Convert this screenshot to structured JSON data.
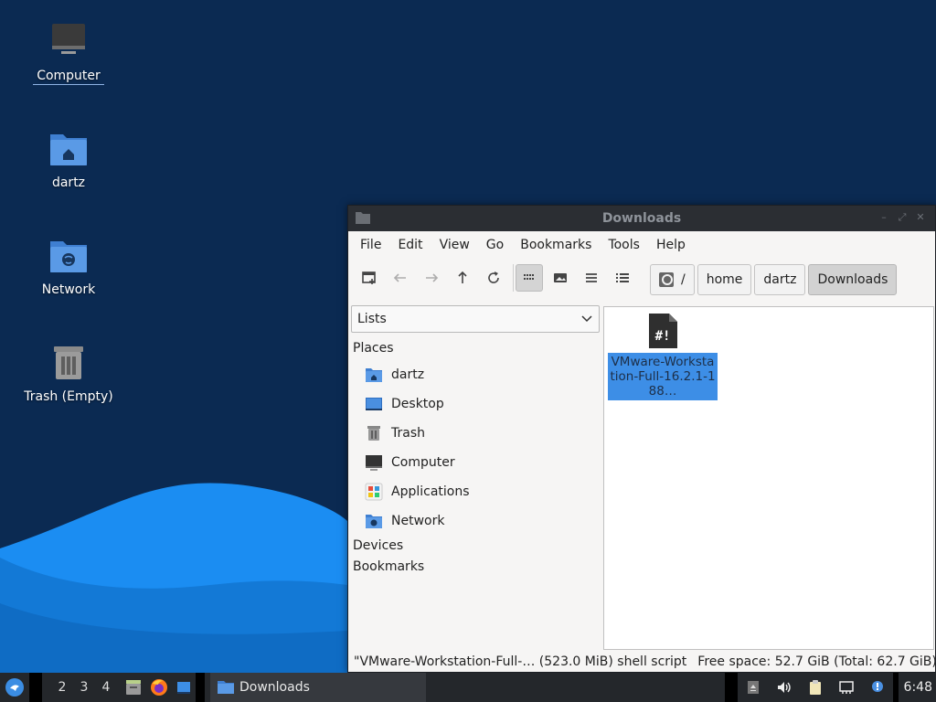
{
  "desktop": {
    "icons": [
      {
        "label": "Computer",
        "icon": "computer-icon"
      },
      {
        "label": "dartz",
        "icon": "home-folder-icon"
      },
      {
        "label": "Network",
        "icon": "network-folder-icon"
      },
      {
        "label": "Trash (Empty)",
        "icon": "trash-icon"
      }
    ]
  },
  "window": {
    "title": "Downloads",
    "menu": [
      "File",
      "Edit",
      "View",
      "Go",
      "Bookmarks",
      "Tools",
      "Help"
    ],
    "toolbar": {
      "buttons": [
        "new-window-icon",
        "back-icon",
        "forward-icon",
        "up-icon",
        "reload-icon",
        "icon-view-icon",
        "compact-view-icon",
        "list-view-icon",
        "detail-view-icon"
      ]
    },
    "breadcrumbs": [
      "/",
      "home",
      "dartz",
      "Downloads"
    ],
    "sidebar": {
      "select_value": "Lists",
      "places_heading": "Places",
      "places": [
        {
          "label": "dartz",
          "icon": "home-folder-icon"
        },
        {
          "label": "Desktop",
          "icon": "desktop-icon"
        },
        {
          "label": "Trash",
          "icon": "trash-icon"
        },
        {
          "label": "Computer",
          "icon": "computer-icon"
        },
        {
          "label": "Applications",
          "icon": "applications-icon"
        },
        {
          "label": "Network",
          "icon": "network-folder-icon"
        }
      ],
      "devices_heading": "Devices",
      "bookmarks_heading": "Bookmarks"
    },
    "files": [
      {
        "name": "VMware-Workstation-Full-16.2.1-188…",
        "icon": "shell-script-icon",
        "selected": true
      }
    ],
    "status": {
      "selection": "\"VMware-Workstation-Full-… (523.0 MiB) shell script",
      "free_space": "Free space: 52.7 GiB (Total: 62.7 GiB)"
    }
  },
  "taskbar": {
    "workspaces": [
      "2",
      "3",
      "4"
    ],
    "launchers": [
      "file-manager-icon",
      "firefox-icon",
      "show-desktop-icon"
    ],
    "task": "Downloads",
    "tray": [
      "eject-icon",
      "volume-icon",
      "clipboard-icon",
      "network-icon",
      "notification-icon"
    ],
    "clock": "6:48"
  },
  "colors": {
    "desktop_bg": "#0b2a52",
    "wave": "#1e90ff",
    "selection": "#3d8ee6",
    "titlebar": "#2b2e33"
  }
}
